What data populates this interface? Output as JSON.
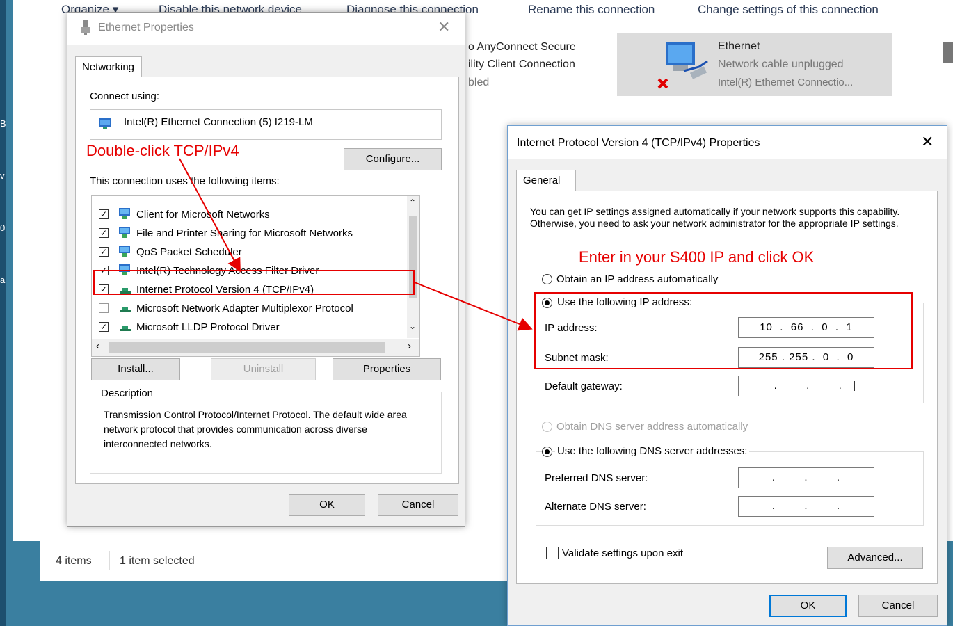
{
  "explorer": {
    "toolbar": [
      "Organize ▾",
      "Disable this network device",
      "Diagnose this connection",
      "Rename this connection",
      "Change settings of this connection"
    ],
    "other_connection": {
      "line1": "o AnyConnect Secure",
      "line2": "ility Client Connection",
      "line3": "bled"
    },
    "ethernet_tile": {
      "name": "Ethernet",
      "status": "Network cable unplugged",
      "adapter": "Intel(R) Ethernet Connectio..."
    },
    "status_bar": {
      "items": "4 items",
      "selected": "1 item selected"
    },
    "desktop_fragments": [
      "B",
      "v",
      "0",
      "a"
    ]
  },
  "eth_dialog": {
    "title": "Ethernet Properties",
    "close": "✕",
    "tab": "Networking",
    "connect_using_label": "Connect using:",
    "adapter_name": "Intel(R) Ethernet Connection (5) I219-LM",
    "configure_button": "Configure...",
    "items_label": "This connection uses the following items:",
    "items": [
      {
        "label": "Client for Microsoft Networks",
        "checked": true,
        "icon": "network-client-icon"
      },
      {
        "label": "File and Printer Sharing for Microsoft Networks",
        "checked": true,
        "icon": "network-client-icon"
      },
      {
        "label": "QoS Packet Scheduler",
        "checked": true,
        "icon": "network-client-icon"
      },
      {
        "label": "Intel(R) Technology Access Filter Driver",
        "checked": true,
        "icon": "network-client-icon"
      },
      {
        "label": "Internet Protocol Version 4 (TCP/IPv4)",
        "checked": true,
        "icon": "protocol-icon"
      },
      {
        "label": "Microsoft Network Adapter Multiplexor Protocol",
        "checked": false,
        "icon": "protocol-icon"
      },
      {
        "label": "Microsoft LLDP Protocol Driver",
        "checked": true,
        "icon": "protocol-icon"
      }
    ],
    "install_button": "Install...",
    "uninstall_button": "Uninstall",
    "properties_button": "Properties",
    "description_title": "Description",
    "description_text": "Transmission Control Protocol/Internet Protocol. The default wide area network protocol that provides communication across diverse interconnected networks.",
    "ok_button": "OK",
    "cancel_button": "Cancel"
  },
  "ip_dialog": {
    "title": "Internet Protocol Version 4 (TCP/IPv4) Properties",
    "close": "✕",
    "tab": "General",
    "intro": "You can get IP settings assigned automatically if your network supports this capability. Otherwise, you need to ask your network administrator for the appropriate IP settings.",
    "obtain_ip_auto": "Obtain an IP address automatically",
    "use_following_ip": "Use the following IP address:",
    "ip_address_label": "IP address:",
    "ip_address_value": "10  .  66  .  0  .  1",
    "subnet_mask_label": "Subnet mask:",
    "subnet_mask_value": "255 . 255 .  0  .  0",
    "default_gateway_label": "Default gateway:",
    "default_gateway_value": "     .        .        .   |",
    "obtain_dns_auto": "Obtain DNS server address automatically",
    "use_following_dns": "Use the following DNS server addresses:",
    "preferred_dns_label": "Preferred DNS server:",
    "preferred_dns_value": "     .        .        .     ",
    "alternate_dns_label": "Alternate DNS server:",
    "alternate_dns_value": "     .        .        .     ",
    "validate_label": "Validate settings upon exit",
    "advanced_button": "Advanced...",
    "ok_button": "OK",
    "cancel_button": "Cancel"
  },
  "annotations": {
    "double_click": "Double-click TCP/IPv4",
    "enter_ip": "Enter in your S400 IP and click OK",
    "color": "#e60000"
  }
}
